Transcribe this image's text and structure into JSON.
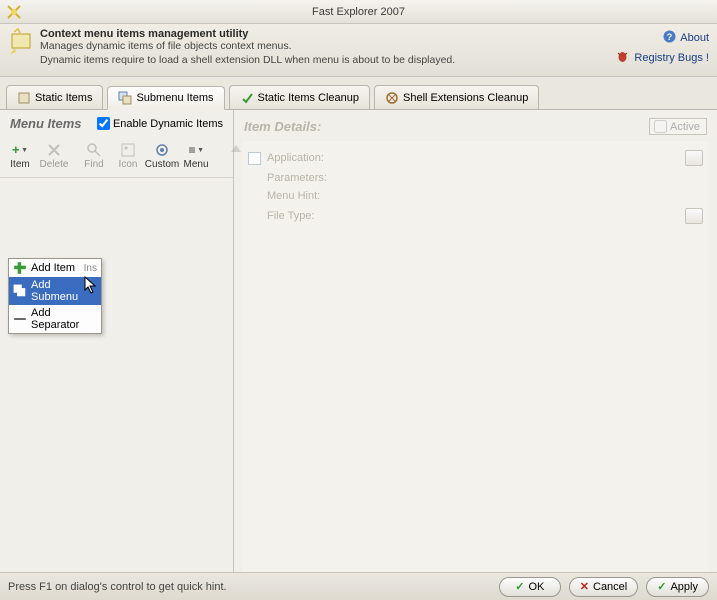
{
  "window": {
    "title": "Fast Explorer 2007"
  },
  "header": {
    "title": "Context menu items management utility",
    "desc1": "Manages dynamic items of file objects context menus.",
    "desc2": "Dynamic items require to load a shell extension DLL when menu is about to be displayed.",
    "links": {
      "about": "About",
      "bugs": "Registry Bugs !"
    }
  },
  "tabs": {
    "static": "Static Items",
    "submenu": "Submenu Items",
    "cleanup": "Static Items Cleanup",
    "shellext": "Shell Extensions Cleanup"
  },
  "left": {
    "title": "Menu Items",
    "enable_dynamic": "Enable Dynamic Items",
    "toolbar": {
      "item": "Item",
      "delete": "Delete",
      "find": "Find",
      "icon": "Icon",
      "custom": "Custom",
      "menu": "Menu"
    },
    "dropdown": {
      "add_item": "Add Item",
      "add_item_shortcut": "Ins",
      "add_submenu": "Add Submenu",
      "add_separator": "Add Separator"
    }
  },
  "details": {
    "title": "Item Details:",
    "active": "Active",
    "application": "Application:",
    "parameters": "Parameters:",
    "menu_hint": "Menu Hint:",
    "file_type": "File Type:"
  },
  "status": {
    "hint": "Press F1 on dialog's control to get quick hint."
  },
  "buttons": {
    "ok": "OK",
    "cancel": "Cancel",
    "apply": "Apply"
  }
}
